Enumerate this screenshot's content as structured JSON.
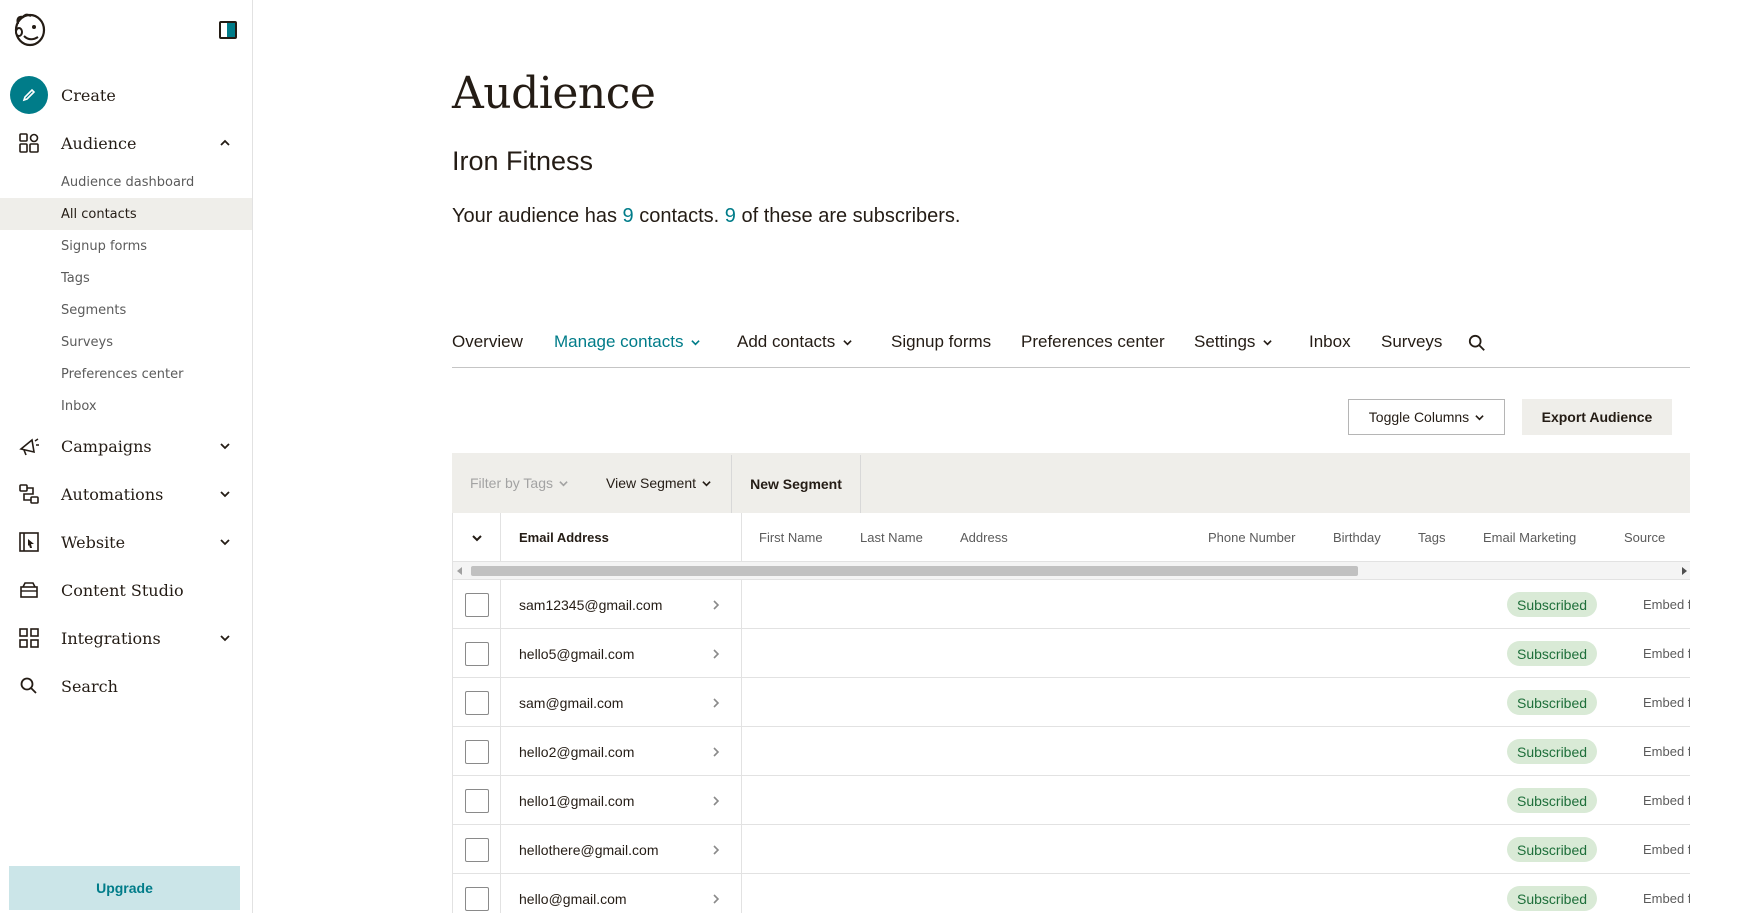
{
  "sidebar": {
    "nav": {
      "create": "Create",
      "audience": "Audience",
      "campaigns": "Campaigns",
      "automations": "Automations",
      "website": "Website",
      "content_studio": "Content Studio",
      "integrations": "Integrations",
      "search": "Search"
    },
    "audience_sub": [
      "Audience dashboard",
      "All contacts",
      "Signup forms",
      "Tags",
      "Segments",
      "Surveys",
      "Preferences center",
      "Inbox"
    ],
    "active_sub": "All contacts",
    "upgrade_label": "Upgrade"
  },
  "header": {
    "title": "Audience",
    "audience_name": "Iron Fitness",
    "summary": {
      "prefix": "Your audience has ",
      "contacts": "9",
      "middle": " contacts. ",
      "subscribers": "9",
      "suffix": " of these are subscribers."
    }
  },
  "tabs": {
    "overview": "Overview",
    "manage_contacts": "Manage contacts",
    "add_contacts": "Add contacts",
    "signup_forms": "Signup forms",
    "preferences_center": "Preferences center",
    "settings": "Settings",
    "inbox": "Inbox",
    "surveys": "Surveys"
  },
  "toolbar": {
    "toggle_columns": "Toggle Columns",
    "export_audience": "Export Audience"
  },
  "filters": {
    "filter_by_tags": "Filter by Tags",
    "view_segment": "View Segment",
    "new_segment": "New Segment"
  },
  "table": {
    "columns": {
      "email": "Email Address",
      "first_name": "First Name",
      "last_name": "Last Name",
      "address": "Address",
      "phone": "Phone Number",
      "birthday": "Birthday",
      "tags": "Tags",
      "email_marketing": "Email Marketing",
      "source": "Source"
    },
    "rows": [
      {
        "email": "sam12345@gmail.com",
        "status": "Subscribed",
        "source": "Embed f"
      },
      {
        "email": "hello5@gmail.com",
        "status": "Subscribed",
        "source": "Embed f"
      },
      {
        "email": "sam@gmail.com",
        "status": "Subscribed",
        "source": "Embed f"
      },
      {
        "email": "hello2@gmail.com",
        "status": "Subscribed",
        "source": "Embed f"
      },
      {
        "email": "hello1@gmail.com",
        "status": "Subscribed",
        "source": "Embed f"
      },
      {
        "email": "hellothere@gmail.com",
        "status": "Subscribed",
        "source": "Embed f"
      },
      {
        "email": "hello@gmail.com",
        "status": "Subscribed",
        "source": "Embed f"
      }
    ]
  },
  "colors": {
    "accent": "#007c89",
    "badge_bg": "#d9ead6",
    "badge_text": "#1e6f3a",
    "upgrade_bg": "#cbe5e8"
  }
}
